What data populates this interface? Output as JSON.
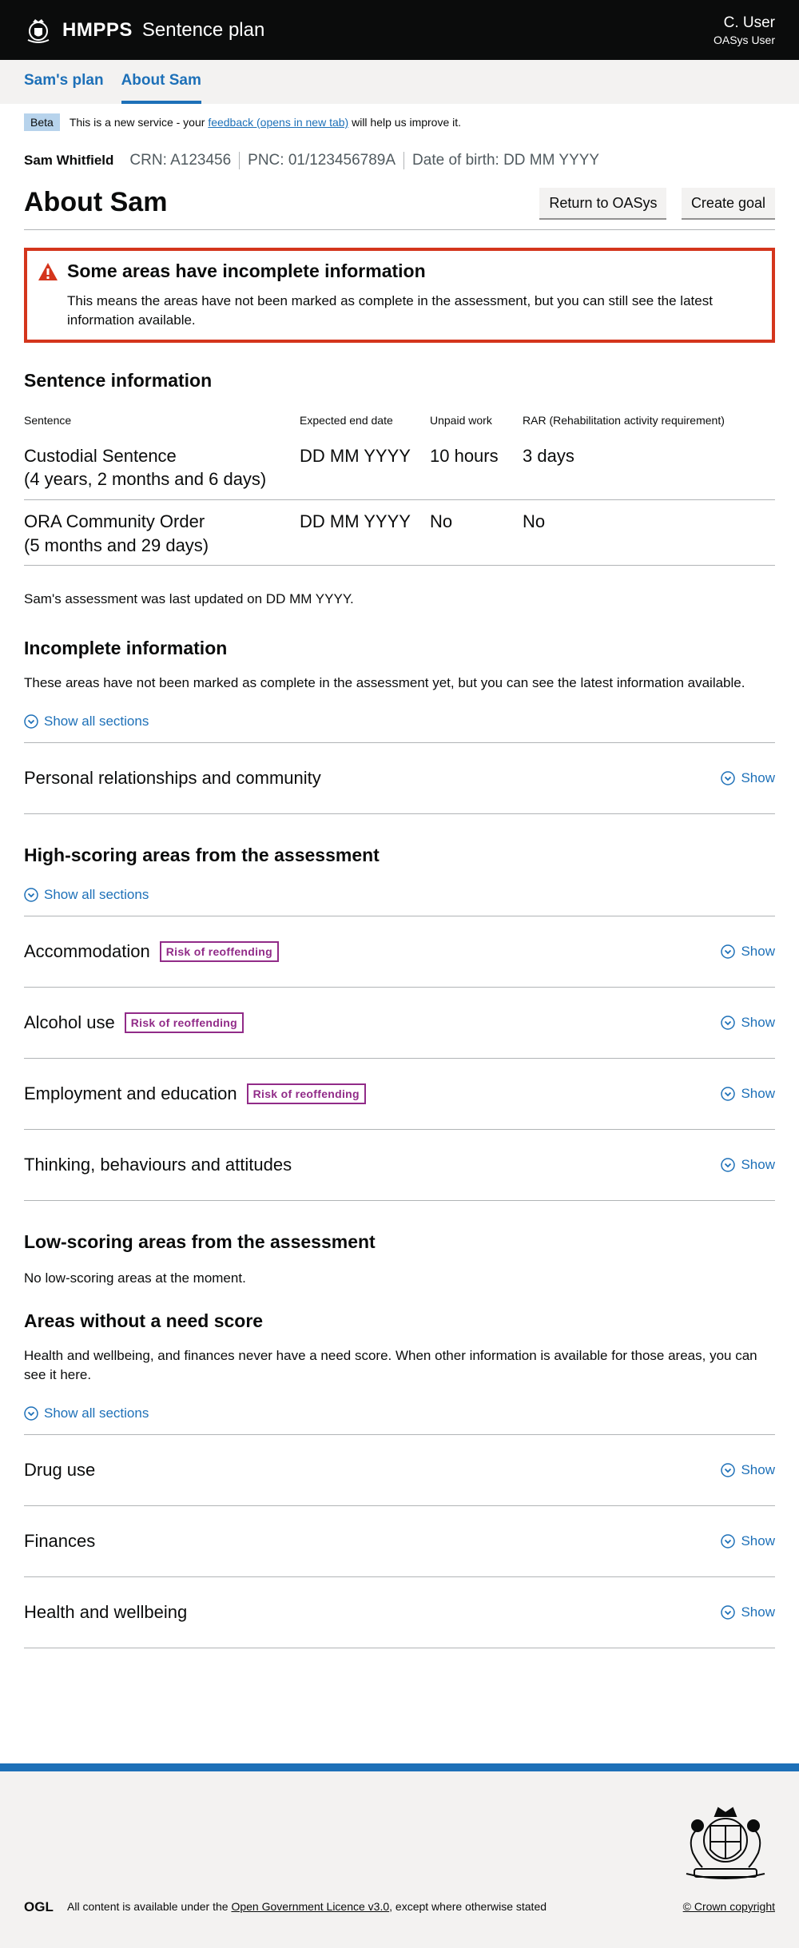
{
  "header": {
    "brand": "HMPPS",
    "service": "Sentence plan",
    "user_name": "C. User",
    "user_role": "OASys User"
  },
  "nav": {
    "items": [
      {
        "label": "Sam's plan"
      },
      {
        "label": "About Sam"
      }
    ]
  },
  "beta": {
    "tag": "Beta",
    "text_before": "This is a new service - your",
    "link": "feedback (opens in new tab)",
    "text_after": "will help us improve it."
  },
  "person": {
    "name": "Sam Whitfield",
    "crn": "CRN:  A123456",
    "pnc": "PNC:  01/123456789A",
    "dob": "Date of birth:  DD MM YYYY"
  },
  "page": {
    "title": "About Sam",
    "return_button": "Return to OASys",
    "create_button": "Create goal"
  },
  "warning": {
    "title": "Some areas have incomplete information",
    "body": "This means the areas have not been marked as complete in the assessment, but you can still see the latest information available."
  },
  "sentence": {
    "heading": "Sentence information",
    "headers": [
      "Sentence",
      "Expected end date",
      "Unpaid work",
      "RAR (Rehabilitation activity requirement)"
    ],
    "rows": [
      {
        "name": "Custodial Sentence",
        "duration": "(4 years, 2 months and 6 days)",
        "end": "DD MM YYYY",
        "unpaid": "10 hours",
        "rar": "3 days"
      },
      {
        "name": "ORA Community Order",
        "duration": "(5 months and 29 days)",
        "end": "DD MM YYYY",
        "unpaid": "No",
        "rar": "No"
      }
    ]
  },
  "assessment_updated": "Sam's assessment was last updated on DD MM YYYY.",
  "incomplete": {
    "heading": "Incomplete information",
    "intro": "These areas have not been marked as complete in the assessment yet, but you can see the latest information available.",
    "show_all": "Show all sections",
    "areas": [
      {
        "title": "Personal relationships and community",
        "show": "Show"
      }
    ]
  },
  "high_scoring": {
    "heading": "High-scoring areas from the assessment",
    "show_all": "Show all sections",
    "areas": [
      {
        "title": "Accommodation",
        "tag": "Risk of reoffending",
        "show": "Show"
      },
      {
        "title": "Alcohol use",
        "tag": "Risk of reoffending",
        "show": "Show"
      },
      {
        "title": "Employment and education",
        "tag": "Risk of reoffending",
        "show": "Show"
      },
      {
        "title": "Thinking, behaviours and attitudes",
        "show": "Show"
      }
    ]
  },
  "low_scoring": {
    "heading": "Low-scoring areas from the assessment",
    "text": "No low-scoring areas at the moment."
  },
  "no_need": {
    "heading": "Areas without a need score",
    "intro": "Health and wellbeing, and finances never have a need score. When other information is available for those areas, you can see it here.",
    "show_all": "Show all sections",
    "areas": [
      {
        "title": "Drug use",
        "show": "Show"
      },
      {
        "title": "Finances",
        "show": "Show"
      },
      {
        "title": "Health and wellbeing",
        "show": "Show"
      }
    ]
  },
  "footer": {
    "licence_before": "All content is available under the",
    "licence_link": "Open Government Licence v3.0",
    "licence_after": ", except where otherwise stated",
    "copyright": "© Crown copyright"
  },
  "colors": {
    "link": "#1d70b8",
    "error": "#d4351c",
    "risk_tag": "#912b88",
    "header_bg": "#0b0c0c",
    "footer_bg": "#f3f2f1"
  }
}
